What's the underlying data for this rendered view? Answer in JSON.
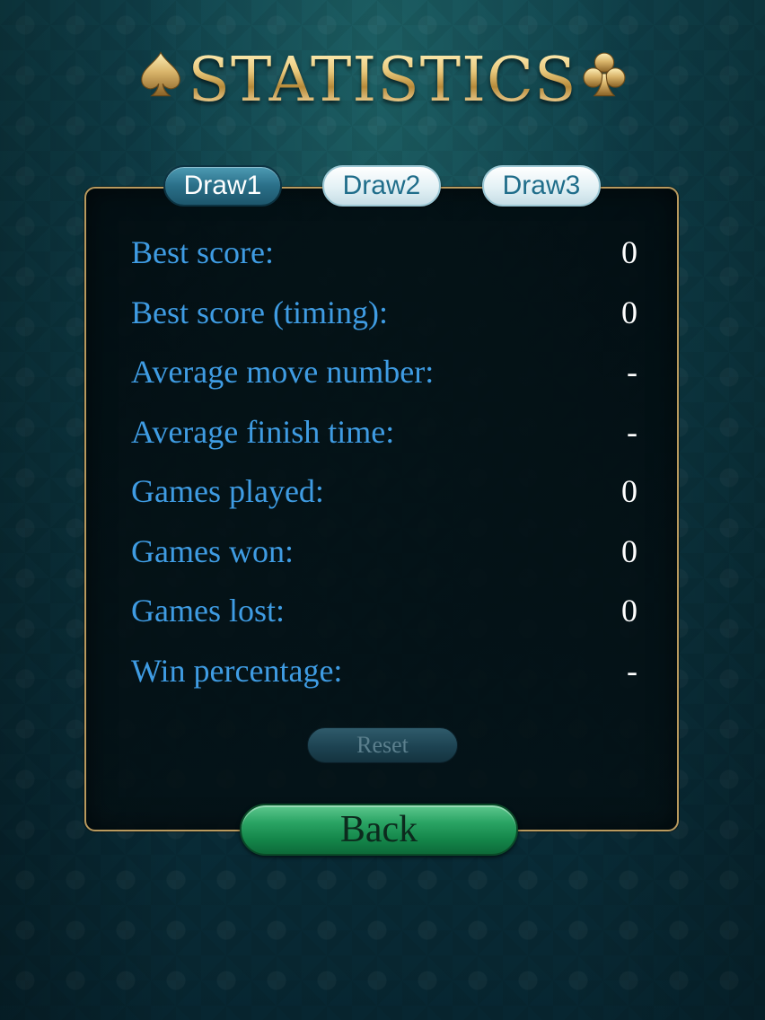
{
  "header": {
    "title": "STATISTICS",
    "left_icon": "spade-icon",
    "right_icon": "club-icon"
  },
  "tabs": [
    {
      "label": "Draw1",
      "active": true
    },
    {
      "label": "Draw2",
      "active": false
    },
    {
      "label": "Draw3",
      "active": false
    }
  ],
  "stats": [
    {
      "label": "Best score:",
      "value": "0"
    },
    {
      "label": "Best score (timing):",
      "value": "0"
    },
    {
      "label": "Average move number:",
      "value": "-"
    },
    {
      "label": "Average finish time:",
      "value": "-"
    },
    {
      "label": "Games played:",
      "value": "0"
    },
    {
      "label": "Games won:",
      "value": "0"
    },
    {
      "label": "Games lost:",
      "value": "0"
    },
    {
      "label": "Win percentage:",
      "value": "-"
    }
  ],
  "actions": {
    "reset_label": "Reset",
    "back_label": "Back"
  },
  "colors": {
    "label_blue": "#3f9ce3",
    "gold": "#d8b56a",
    "back_green": "#14864a",
    "panel_border": "#b99a5e"
  }
}
